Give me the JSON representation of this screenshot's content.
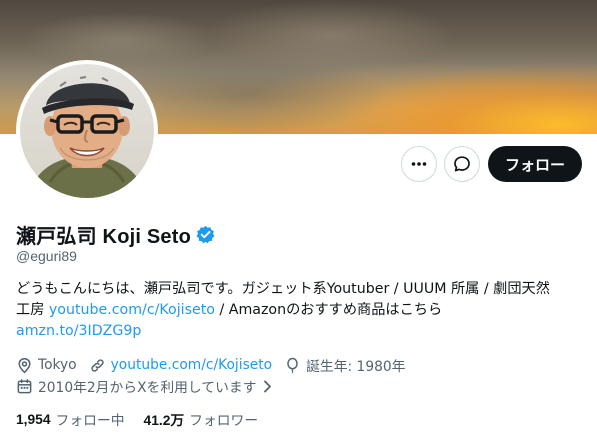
{
  "profile": {
    "display_name": "瀬戸弘司 Koji Seto",
    "handle": "@eguri89",
    "follow_label": "フォロー",
    "bio": {
      "line1": "どうもこんにちは、瀬戸弘司です。ガジェット系Youtuber / UUUM 所属 / 劇団天然",
      "line2_prefix": "工房 ",
      "line2_link": "youtube.com/c/Kojiseto",
      "line2_suffix": " / Amazonのおすすめ商品はこちら",
      "line3_link": "amzn.to/3IDZG9p"
    },
    "location": "Tokyo",
    "website": "youtube.com/c/Kojiseto",
    "birthdate": "誕生年: 1980年",
    "joined": "2010年2月からXを利用しています",
    "following_count": "1,954",
    "following_label": "フォロー中",
    "followers_count": "41.2万",
    "followers_label": "フォロワー"
  },
  "icons": {
    "more": "more-horizontal-icon",
    "message": "message-bubble-icon",
    "verified": "verified-badge-icon",
    "location": "location-pin-icon",
    "link": "link-icon",
    "birthday": "balloon-icon",
    "calendar": "calendar-icon",
    "chevron": "chevron-right-icon"
  },
  "colors": {
    "link": "#1d9bf0",
    "follow_button": "#0f1419",
    "secondary_text": "#536471"
  }
}
